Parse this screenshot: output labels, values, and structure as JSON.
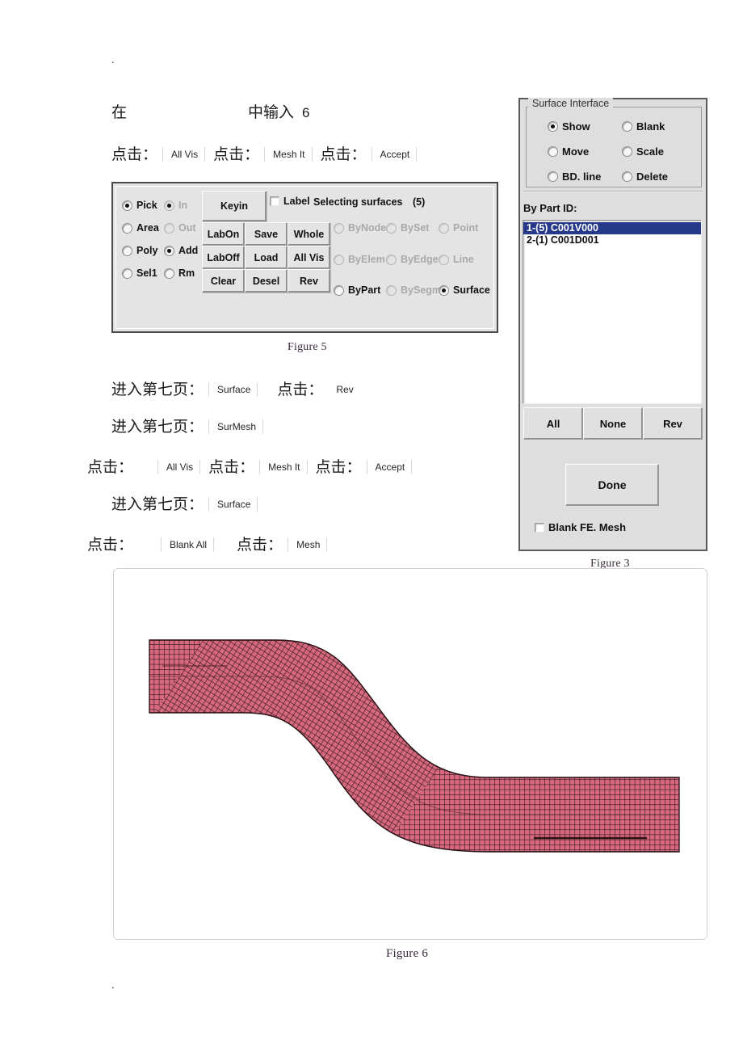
{
  "page": {
    "top_marker": ".",
    "bottom_marker": "."
  },
  "instructions": {
    "line1": {
      "prefix": "在",
      "suffix": "中输入",
      "value": "6"
    },
    "line2": [
      {
        "label": "点击：",
        "value": "All Vis"
      },
      {
        "label": "点击：",
        "value": "Mesh It"
      },
      {
        "label": "点击：",
        "value": "Accept"
      }
    ],
    "line3": [
      {
        "label": "进入第七页：",
        "value": "Surface"
      },
      {
        "label": "点击：",
        "value": "Rev"
      }
    ],
    "line4": [
      {
        "label": "进入第七页：",
        "value": "SurMesh"
      }
    ],
    "line5": [
      {
        "label": "点击：",
        "value": "All Vis"
      },
      {
        "label": "点击：",
        "value": "Mesh It"
      },
      {
        "label": "点击：",
        "value": "Accept"
      }
    ],
    "line6": [
      {
        "label": "进入第七页：",
        "value": "Surface"
      }
    ],
    "line7": [
      {
        "label": "点击：",
        "value": "Blank All"
      },
      {
        "label": "点击：",
        "value": "Mesh"
      }
    ]
  },
  "figure5": {
    "caption": "Figure 5",
    "status_text": "Selecting surfaces",
    "count_text": "(5)",
    "label_checkbox": {
      "label": "Label",
      "checked": false
    },
    "mode_radios": [
      {
        "label": "Pick",
        "selected": true,
        "disabled": false
      },
      {
        "label": "Area",
        "selected": false,
        "disabled": false
      },
      {
        "label": "Poly",
        "selected": false,
        "disabled": false
      },
      {
        "label": "Sel1",
        "selected": false,
        "disabled": false
      }
    ],
    "inout_radios": [
      {
        "label": "In",
        "selected": true,
        "disabled": true
      },
      {
        "label": "Out",
        "selected": false,
        "disabled": true
      },
      {
        "label": "Add",
        "selected": true,
        "disabled": false
      },
      {
        "label": "Rm",
        "selected": false,
        "disabled": false
      }
    ],
    "keyin_button": "Keyin",
    "grid_buttons": [
      [
        "LabOn",
        "Save",
        "Whole"
      ],
      [
        "LabOff",
        "Load",
        "All Vis"
      ],
      [
        "Clear",
        "Desel",
        "Rev"
      ]
    ],
    "entity_radios": [
      {
        "label": "ByNode",
        "selected": false,
        "disabled": true
      },
      {
        "label": "BySet",
        "selected": false,
        "disabled": true
      },
      {
        "label": "Point",
        "selected": false,
        "disabled": true
      },
      {
        "label": "ByElem",
        "selected": false,
        "disabled": true
      },
      {
        "label": "ByEdge",
        "selected": false,
        "disabled": true
      },
      {
        "label": "Line",
        "selected": false,
        "disabled": true
      },
      {
        "label": "ByPart",
        "selected": false,
        "disabled": false
      },
      {
        "label": "BySegm",
        "selected": false,
        "disabled": true
      },
      {
        "label": "Surface",
        "selected": true,
        "disabled": false
      }
    ]
  },
  "figure3": {
    "caption": "Figure 3",
    "group_title": "Surface Interface",
    "action_radios": [
      {
        "label": "Show",
        "selected": true
      },
      {
        "label": "Blank",
        "selected": false
      },
      {
        "label": "Move",
        "selected": false
      },
      {
        "label": "Scale",
        "selected": false
      },
      {
        "label": "BD. line",
        "selected": false
      },
      {
        "label": "Delete",
        "selected": false
      }
    ],
    "list_label": "By Part ID:",
    "list_items": [
      {
        "text": "1-(5) C001V000",
        "selected": true
      },
      {
        "text": "2-(1) C001D001",
        "selected": false
      }
    ],
    "selection_buttons": [
      "All",
      "None",
      "Rev"
    ],
    "done_button": "Done",
    "blank_checkbox": {
      "label": "Blank FE. Mesh",
      "checked": false
    },
    "highlight_color": "#26388a"
  },
  "figure6": {
    "caption": "Figure 6",
    "mesh": {
      "fill_color": "#d9697f",
      "line_color": "#2b1418",
      "description": "S-shaped (Z-bend) finite element shell mesh of a curved sheet-metal strip"
    }
  }
}
